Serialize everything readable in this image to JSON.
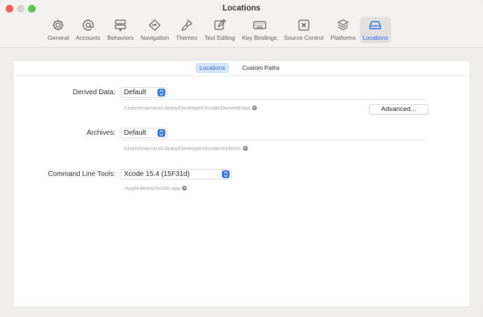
{
  "window": {
    "title": "Locations"
  },
  "toolbar": {
    "items": [
      {
        "label": "General",
        "icon": "gear-icon"
      },
      {
        "label": "Accounts",
        "icon": "at-icon"
      },
      {
        "label": "Behaviors",
        "icon": "behaviors-icon"
      },
      {
        "label": "Navigation",
        "icon": "navigation-icon"
      },
      {
        "label": "Themes",
        "icon": "brush-icon"
      },
      {
        "label": "Text Editing",
        "icon": "edit-icon"
      },
      {
        "label": "Key Bindings",
        "icon": "keyboard-icon"
      },
      {
        "label": "Source Control",
        "icon": "source-control-icon"
      },
      {
        "label": "Platforms",
        "icon": "layers-icon"
      },
      {
        "label": "Locations",
        "icon": "drive-icon"
      }
    ],
    "active": "Locations"
  },
  "tabs": [
    {
      "label": "Locations",
      "selected": true
    },
    {
      "label": "Custom Paths",
      "selected": false
    }
  ],
  "derived": {
    "label": "Derived Data:",
    "value": "Default",
    "path": "/Users/macmini/Library/Developer/Xcode/DerivedData",
    "advanced": "Advanced..."
  },
  "archives": {
    "label": "Archives:",
    "value": "Default",
    "path": "/Users/macmini/Library/Developer/Xcode/Archives"
  },
  "clt": {
    "label": "Command Line Tools:",
    "value": "Xcode 15.4 (15F31d)",
    "path": "/Applications/Xcode.app"
  },
  "colors": {
    "accent": "#2f6fe0",
    "close": "#ee5e57",
    "zoom": "#5fc24f"
  }
}
